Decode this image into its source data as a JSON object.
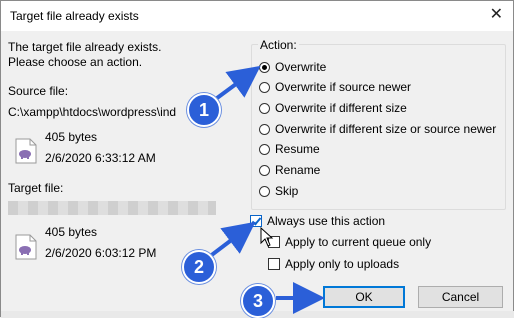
{
  "window": {
    "title": "Target file already exists",
    "close_glyph": "✕"
  },
  "message": {
    "line1": "The target file already exists.",
    "line2": "Please choose an action."
  },
  "source": {
    "label": "Source file:",
    "path": "C:\\xampp\\htdocs\\wordpress\\ind",
    "size": "405 bytes",
    "date": "2/6/2020 6:33:12 AM"
  },
  "target": {
    "label": "Target file:",
    "size": "405 bytes",
    "date": "2/6/2020 6:03:12 PM"
  },
  "action": {
    "legend": "Action:",
    "options": [
      "Overwrite",
      "Overwrite if source newer",
      "Overwrite if different size",
      "Overwrite if different size or source newer",
      "Resume",
      "Rename",
      "Skip"
    ],
    "selected": "Overwrite"
  },
  "checkboxes": {
    "always": {
      "label": "Always use this action",
      "checked": true
    },
    "queue": {
      "label": "Apply to current queue only",
      "checked": false
    },
    "uploads": {
      "label": "Apply only to uploads",
      "checked": false
    }
  },
  "buttons": {
    "ok": "OK",
    "cancel": "Cancel"
  },
  "callouts": {
    "one": "1",
    "two": "2",
    "three": "3"
  },
  "colors": {
    "accent": "#2b5fd8",
    "arrow": "#2b5fd8",
    "checkbox": "#0a64c8"
  },
  "icons": {
    "file": "elephant-php-file-icon",
    "close": "close-icon"
  }
}
